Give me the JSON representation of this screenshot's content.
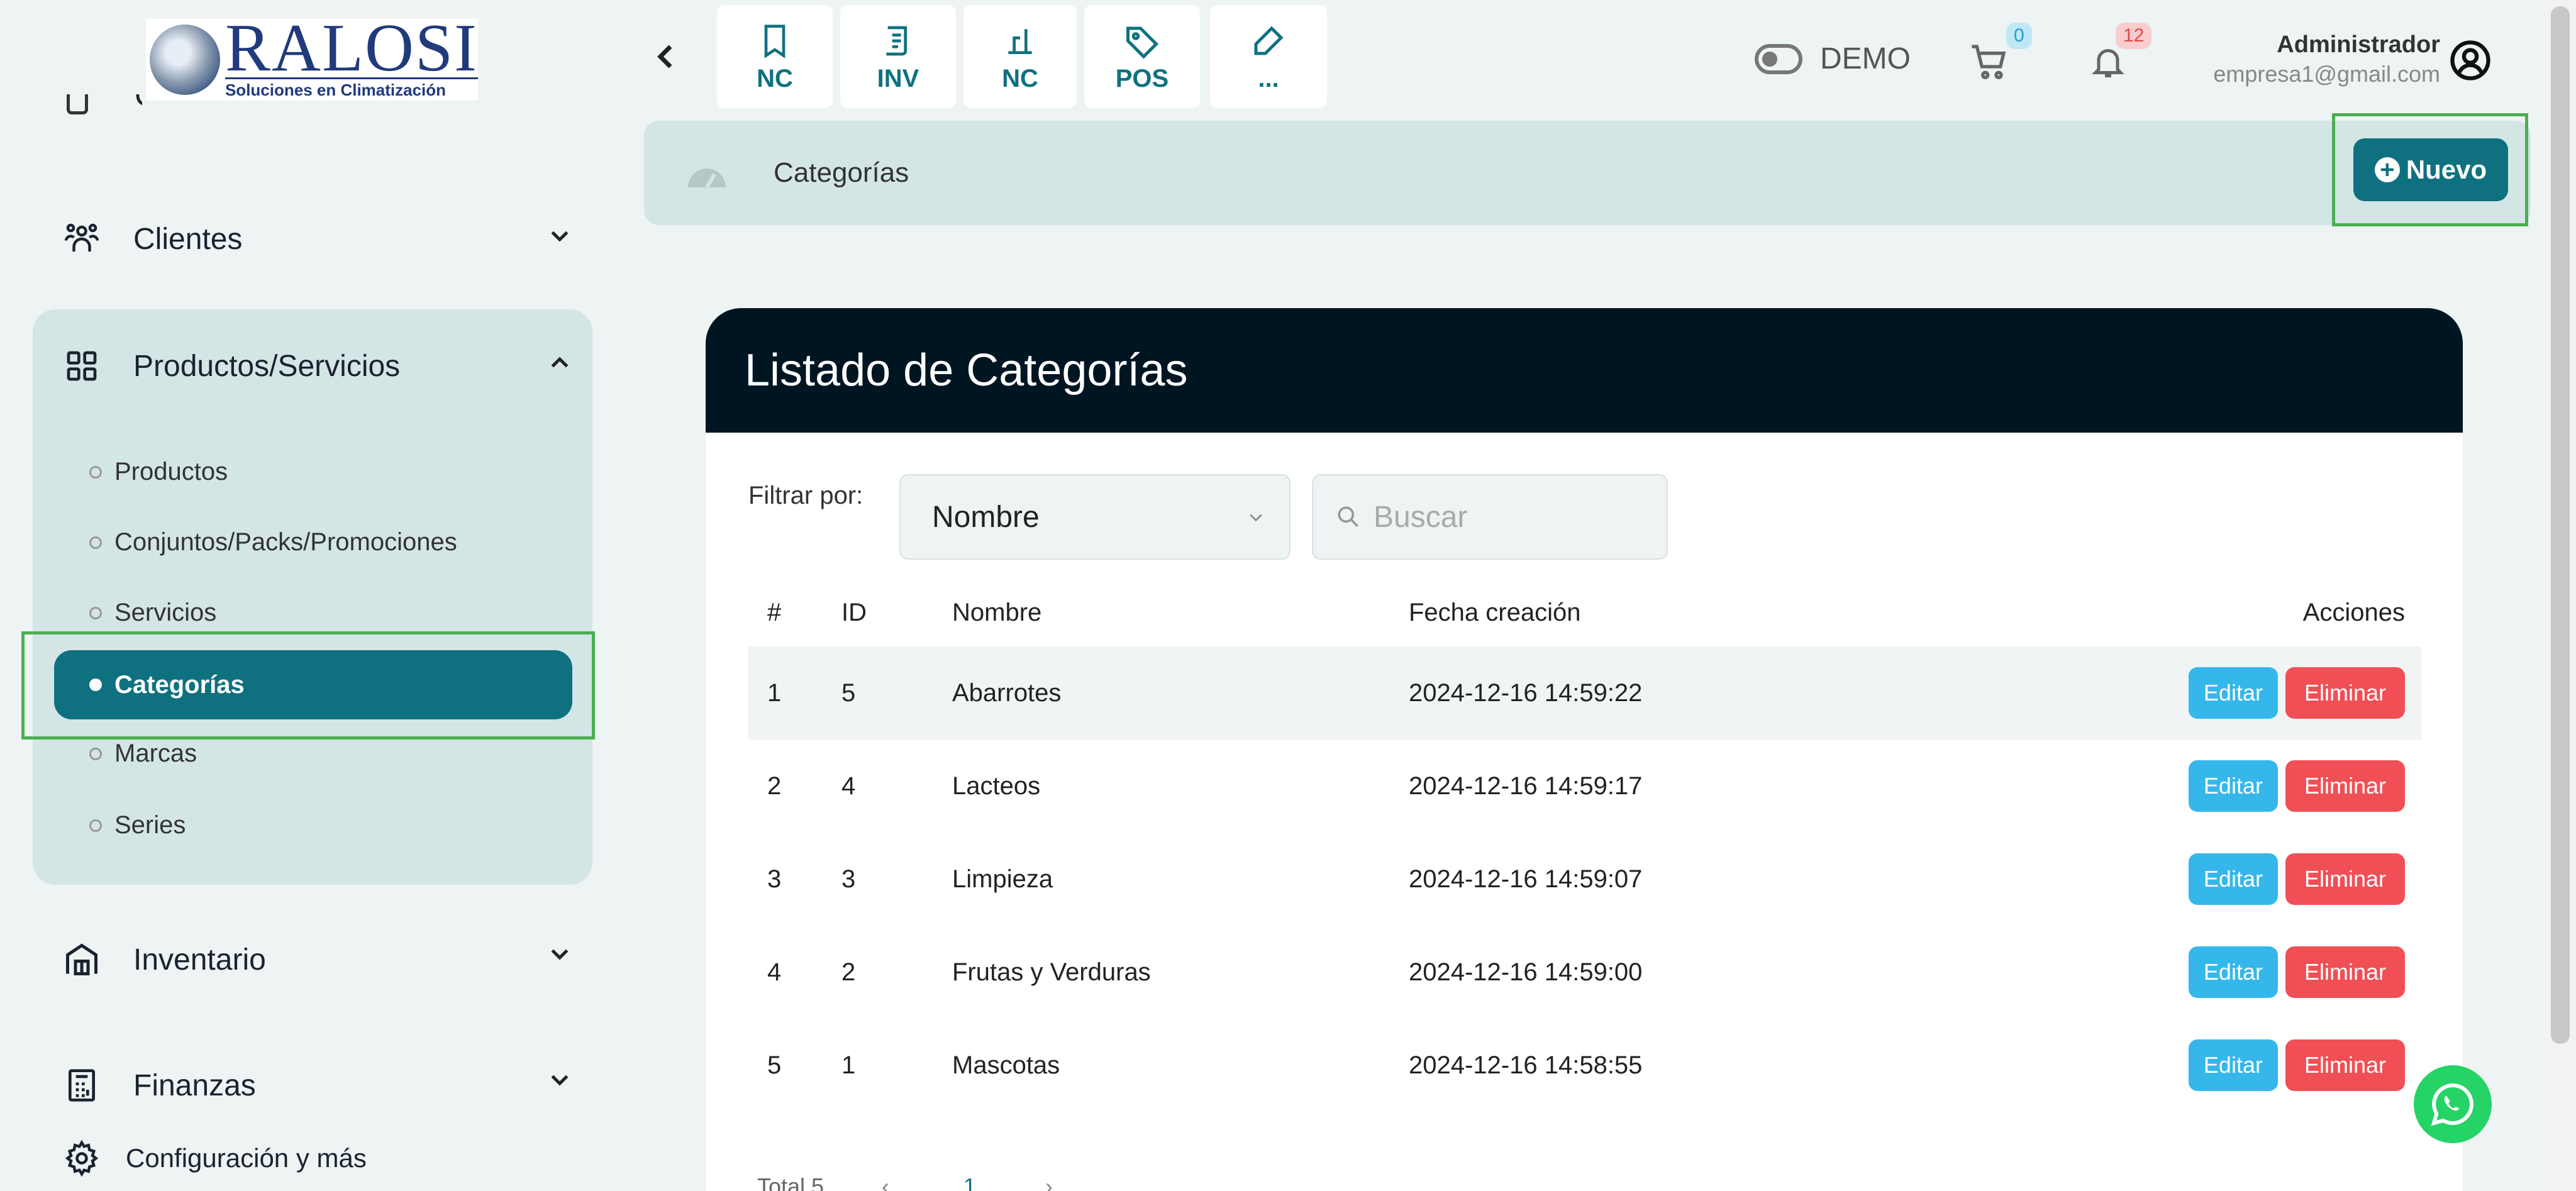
{
  "brand": {
    "name": "RALOSI",
    "tagline": "Soluciones en Climatización"
  },
  "sidebar": {
    "partial_item": "Compras",
    "clientes": "Clientes",
    "productos": "Productos/Servicios",
    "sub_items": [
      "Productos",
      "Conjuntos/Packs/Promociones",
      "Servicios",
      "Categorías",
      "Marcas",
      "Series"
    ],
    "inventario": "Inventario",
    "finanzas": "Finanzas",
    "config": "Configuración y más"
  },
  "quick_actions": [
    "NC",
    "INV",
    "NC",
    "POS",
    "..."
  ],
  "header": {
    "demo_label": "DEMO",
    "cart_count": "0",
    "notif_count": "12",
    "user_name": "Administrador",
    "user_email": "empresa1@gmail.com"
  },
  "breadcrumb": {
    "title": "Categorías"
  },
  "nuevo_label": "Nuevo",
  "card": {
    "title": "Listado de Categorías",
    "filter_label": "Filtrar por:",
    "filter_value": "Nombre",
    "search_placeholder": "Buscar"
  },
  "table": {
    "headers": [
      "#",
      "ID",
      "Nombre",
      "Fecha creación",
      "Acciones"
    ],
    "rows": [
      {
        "n": "1",
        "id": "5",
        "nombre": "Abarrotes",
        "fecha": "2024-12-16 14:59:22"
      },
      {
        "n": "2",
        "id": "4",
        "nombre": "Lacteos",
        "fecha": "2024-12-16 14:59:17"
      },
      {
        "n": "3",
        "id": "3",
        "nombre": "Limpieza",
        "fecha": "2024-12-16 14:59:07"
      },
      {
        "n": "4",
        "id": "2",
        "nombre": "Frutas y Verduras",
        "fecha": "2024-12-16 14:59:00"
      },
      {
        "n": "5",
        "id": "1",
        "nombre": "Mascotas",
        "fecha": "2024-12-16 14:58:55"
      }
    ],
    "edit_label": "Editar",
    "delete_label": "Eliminar"
  },
  "pagination": {
    "total": "Total 5",
    "page": "1"
  },
  "colors": {
    "primary": "#0f7180",
    "dark_header": "#001522",
    "edit": "#35b7ec",
    "delete": "#f04f55",
    "highlight": "#4caf50"
  }
}
